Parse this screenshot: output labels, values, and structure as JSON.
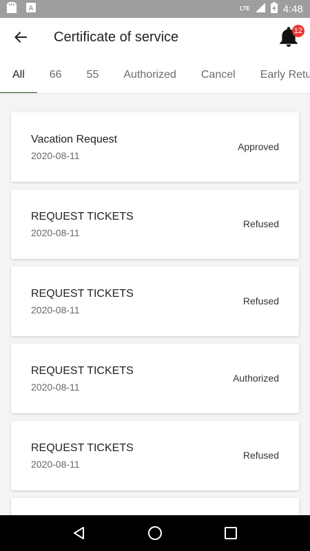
{
  "status_bar": {
    "time": "4:48",
    "network": "LTE"
  },
  "app_bar": {
    "title": "Certificate of service",
    "notification_count": "12"
  },
  "tabs": [
    {
      "label": "All",
      "active": true
    },
    {
      "label": "66",
      "active": false
    },
    {
      "label": "55",
      "active": false
    },
    {
      "label": "Authorized",
      "active": false
    },
    {
      "label": "Cancel",
      "active": false
    },
    {
      "label": "Early Return",
      "active": false
    }
  ],
  "requests": [
    {
      "title": "Vacation Request",
      "date": "2020-08-11",
      "status": "Approved"
    },
    {
      "title": "REQUEST TICKETS",
      "date": "2020-08-11",
      "status": "Refused"
    },
    {
      "title": "REQUEST TICKETS",
      "date": "2020-08-11",
      "status": "Refused"
    },
    {
      "title": "REQUEST TICKETS",
      "date": "2020-08-11",
      "status": "Authorized"
    },
    {
      "title": "REQUEST TICKETS",
      "date": "2020-08-11",
      "status": "Refused"
    },
    {
      "title": "",
      "date": "",
      "status": ""
    }
  ],
  "colors": {
    "accent": "#1b5e20",
    "badge": "#e53935",
    "status_bar": "#9e9e9e"
  }
}
